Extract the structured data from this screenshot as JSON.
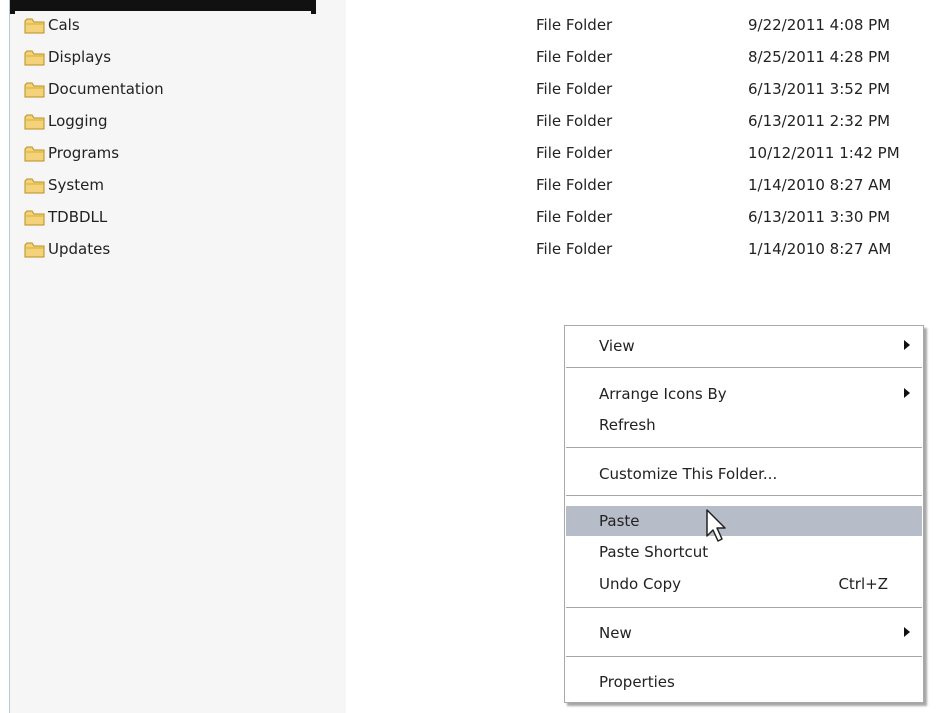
{
  "files": [
    {
      "name": "Cals",
      "type": "File Folder",
      "modified": "9/22/2011 4:08 PM"
    },
    {
      "name": "Displays",
      "type": "File Folder",
      "modified": "8/25/2011 4:28 PM"
    },
    {
      "name": "Documentation",
      "type": "File Folder",
      "modified": "6/13/2011 3:52 PM"
    },
    {
      "name": "Logging",
      "type": "File Folder",
      "modified": "6/13/2011 2:32 PM"
    },
    {
      "name": "Programs",
      "type": "File Folder",
      "modified": "10/12/2011 1:42 PM"
    },
    {
      "name": "System",
      "type": "File Folder",
      "modified": "1/14/2010 8:27 AM"
    },
    {
      "name": "TDBDLL",
      "type": "File Folder",
      "modified": "6/13/2011 3:30 PM"
    },
    {
      "name": "Updates",
      "type": "File Folder",
      "modified": "1/14/2010 8:27 AM"
    }
  ],
  "icons": {
    "folder": "folder-icon",
    "submenu": "submenu-arrow-icon",
    "cursor": "mouse-pointer-icon"
  },
  "colors": {
    "menu_highlight": "#b7bcc9",
    "folder_fill": "#f3d27a",
    "folder_stroke": "#b8901f"
  },
  "context_menu": {
    "view": "View",
    "arrange_icons_by": "Arrange Icons By",
    "refresh": "Refresh",
    "customize": "Customize This Folder...",
    "paste": "Paste",
    "paste_shortcut": "Paste Shortcut",
    "undo_copy": "Undo Copy",
    "undo_copy_shortcut": "Ctrl+Z",
    "new": "New",
    "properties": "Properties",
    "highlighted": "Paste"
  }
}
